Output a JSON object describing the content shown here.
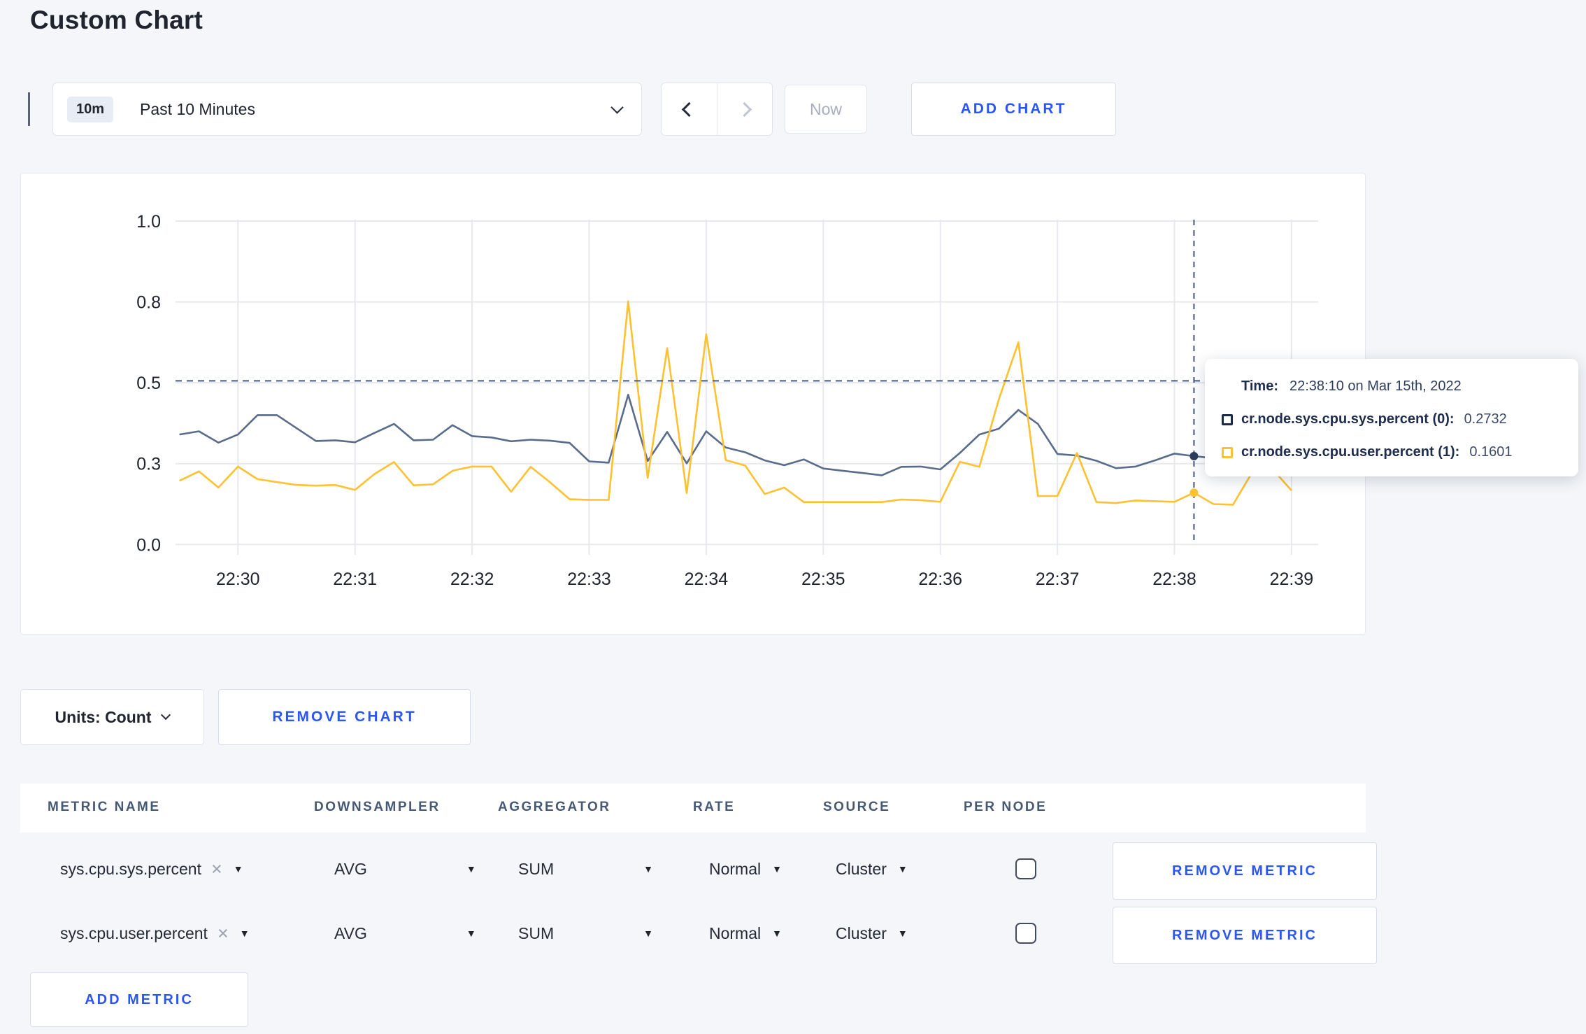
{
  "page": {
    "title": "Custom Chart"
  },
  "toolbar": {
    "range_badge": "10m",
    "range_label": "Past 10 Minutes",
    "now_label": "Now",
    "add_chart_label": "ADD CHART"
  },
  "colors": {
    "accent_blue": "#2a56f5",
    "series_sys_line": "#5a6c8c",
    "series_sys_legend": "#1c2b4a",
    "series_user": "#fdc131",
    "crosshair": "#44597c",
    "grid": "#e7e9ee"
  },
  "chart_data": {
    "type": "line",
    "title": "",
    "x_start_time": "22:29:30",
    "interval_seconds": 10,
    "x_tick_labels": [
      "22:30",
      "22:31",
      "22:32",
      "22:33",
      "22:34",
      "22:35",
      "22:36",
      "22:37",
      "22:38",
      "22:39"
    ],
    "y_tick_labels": [
      "0.0",
      "0.3",
      "0.5",
      "0.8",
      "1.0"
    ],
    "y_gridline_values": [
      0,
      0.25,
      0.5,
      0.75,
      1.0
    ],
    "ylim": [
      0,
      1
    ],
    "legend_position": "tooltip",
    "grid": true,
    "series": [
      {
        "name": "cr.node.sys.cpu.sys.percent",
        "color": "#5a6c8c",
        "values": [
          0.34,
          0.35,
          0.315,
          0.34,
          0.4,
          0.4,
          0.36,
          0.32,
          0.322,
          0.316,
          0.345,
          0.373,
          0.322,
          0.324,
          0.369,
          0.335,
          0.331,
          0.319,
          0.324,
          0.321,
          0.314,
          0.257,
          0.253,
          0.463,
          0.258,
          0.348,
          0.251,
          0.35,
          0.3,
          0.285,
          0.26,
          0.245,
          0.263,
          0.235,
          0.228,
          0.221,
          0.214,
          0.24,
          0.241,
          0.232,
          0.283,
          0.34,
          0.358,
          0.416,
          0.373,
          0.28,
          0.275,
          0.259,
          0.236,
          0.241,
          0.26,
          0.281,
          0.2732,
          0.267,
          0.3,
          0.305,
          0.3,
          0.3
        ]
      },
      {
        "name": "cr.node.sys.cpu.user.percent",
        "color": "#fdc131",
        "values": [
          0.197,
          0.226,
          0.176,
          0.241,
          0.202,
          0.193,
          0.184,
          0.182,
          0.184,
          0.169,
          0.218,
          0.255,
          0.183,
          0.186,
          0.228,
          0.241,
          0.241,
          0.163,
          0.24,
          0.192,
          0.14,
          0.138,
          0.138,
          0.752,
          0.206,
          0.607,
          0.159,
          0.65,
          0.261,
          0.244,
          0.156,
          0.176,
          0.131,
          0.131,
          0.131,
          0.131,
          0.131,
          0.139,
          0.137,
          0.132,
          0.256,
          0.24,
          0.449,
          0.625,
          0.15,
          0.15,
          0.283,
          0.131,
          0.128,
          0.136,
          0.134,
          0.132,
          0.1601,
          0.125,
          0.123,
          0.225,
          0.235,
          0.167
        ]
      }
    ],
    "crosshair": {
      "time": "22:38:10",
      "time_offset_seconds": 520,
      "value_line": 0.506,
      "sys_value": 0.2732,
      "user_value": 0.1601
    }
  },
  "tooltip": {
    "time_label": "Time:",
    "time_value": "22:38:10 on Mar 15th, 2022",
    "rows": [
      {
        "label": "cr.node.sys.cpu.sys.percent (0):",
        "value": "0.2732",
        "color": "#1c2b4a"
      },
      {
        "label": "cr.node.sys.cpu.user.percent (1):",
        "value": "0.1601",
        "color": "#fdc131"
      }
    ]
  },
  "chart_controls": {
    "units_label": "Units: Count",
    "remove_chart_label": "REMOVE CHART"
  },
  "metrics_table": {
    "headers": [
      "METRIC NAME",
      "DOWNSAMPLER",
      "AGGREGATOR",
      "RATE",
      "SOURCE",
      "PER NODE"
    ],
    "close_icon": "×",
    "caret_icon": "▼",
    "rows": [
      {
        "name": "sys.cpu.sys.percent",
        "downsampler": "AVG",
        "aggregator": "SUM",
        "rate": "Normal",
        "source": "Cluster",
        "per_node_checked": false,
        "remove_label": "REMOVE METRIC"
      },
      {
        "name": "sys.cpu.user.percent",
        "downsampler": "AVG",
        "aggregator": "SUM",
        "rate": "Normal",
        "source": "Cluster",
        "per_node_checked": false,
        "remove_label": "REMOVE METRIC"
      }
    ],
    "add_metric_label": "ADD METRIC"
  }
}
